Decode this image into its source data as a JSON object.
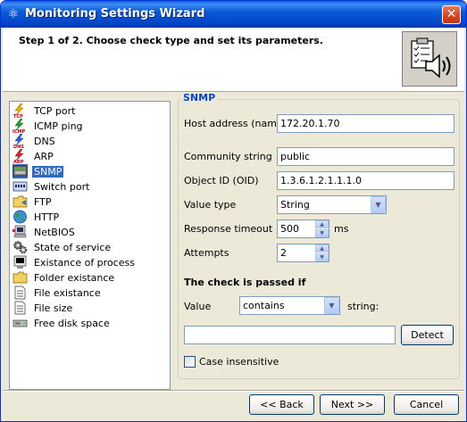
{
  "window": {
    "title": "Monitoring Settings Wizard",
    "close_glyph": "✕"
  },
  "header": {
    "step_text": "Step 1 of 2. Choose check type and set its parameters.",
    "icon": "snmp-audio-icon"
  },
  "check_types": [
    {
      "label": "TCP port",
      "icon": "lightning-tcp-icon",
      "selected": false
    },
    {
      "label": "ICMP ping",
      "icon": "lightning-icmp-icon",
      "selected": false
    },
    {
      "label": "DNS",
      "icon": "lightning-dns-icon",
      "selected": false
    },
    {
      "label": "ARP",
      "icon": "lightning-arp-icon",
      "selected": false
    },
    {
      "label": "SNMP",
      "icon": "snmp-icon",
      "selected": true
    },
    {
      "label": "Switch port",
      "icon": "switch-icon",
      "selected": false
    },
    {
      "label": "FTP",
      "icon": "folder-icon",
      "selected": false
    },
    {
      "label": "HTTP",
      "icon": "globe-icon",
      "selected": false
    },
    {
      "label": "NetBIOS",
      "icon": "computer-icon",
      "selected": false
    },
    {
      "label": "State of service",
      "icon": "gears-icon",
      "selected": false
    },
    {
      "label": "Existance of process",
      "icon": "process-icon",
      "selected": false
    },
    {
      "label": "Folder existance",
      "icon": "folder-icon",
      "selected": false
    },
    {
      "label": "File existance",
      "icon": "file-icon",
      "selected": false
    },
    {
      "label": "File size",
      "icon": "file-icon",
      "selected": false
    },
    {
      "label": "Free disk space",
      "icon": "disk-icon",
      "selected": false
    }
  ],
  "snmp": {
    "group_title": "SNMP",
    "host_label": "Host address (name)",
    "host_value": "172.20.1.70",
    "community_label": "Community string",
    "community_value": "public",
    "oid_label": "Object ID (OID)",
    "oid_value": "1.3.6.1.2.1.1.1.0",
    "value_type_label": "Value type",
    "value_type_value": "String",
    "timeout_label": "Response timeout",
    "timeout_value": "500",
    "timeout_unit": "ms",
    "attempts_label": "Attempts",
    "attempts_value": "2",
    "passed_heading": "The check is passed if",
    "value_label": "Value",
    "condition_value": "contains",
    "string_label": "string:",
    "string_value": "",
    "detect_label": "Detect",
    "case_label": "Case insensitive",
    "case_checked": false
  },
  "footer": {
    "back_label": "<< Back",
    "next_label": "Next >>",
    "cancel_label": "Cancel"
  },
  "colors": {
    "title_blue": "#0a5bd8",
    "selection": "#316ac5",
    "group_title": "#0046d5",
    "face": "#ece9d8"
  }
}
